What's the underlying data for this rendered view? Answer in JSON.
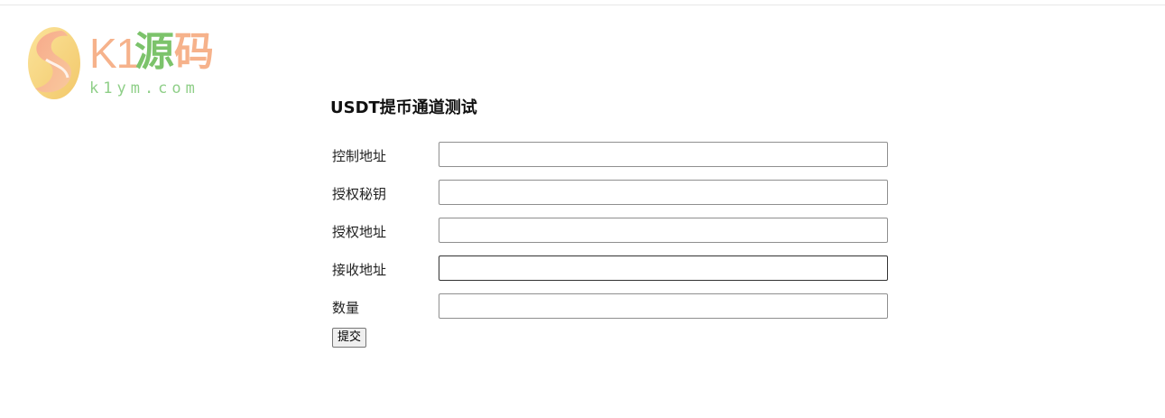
{
  "logo": {
    "brand_k1": "K1",
    "brand_cn_1": "源",
    "brand_cn_2": "码",
    "domain": "k1ym.com",
    "colors": {
      "peach": "#f6b28b",
      "green": "#7cc36b",
      "yellow": "#f5d978"
    }
  },
  "form": {
    "title": "USDT提币通道测试",
    "fields": [
      {
        "label": "控制地址",
        "value": "",
        "placeholder": ""
      },
      {
        "label": "授权秘钥",
        "value": "",
        "placeholder": ""
      },
      {
        "label": "授权地址",
        "value": "",
        "placeholder": ""
      },
      {
        "label": "接收地址",
        "value": "",
        "placeholder": ""
      },
      {
        "label": "数量",
        "value": "",
        "placeholder": ""
      }
    ],
    "submit_label": "提交"
  }
}
